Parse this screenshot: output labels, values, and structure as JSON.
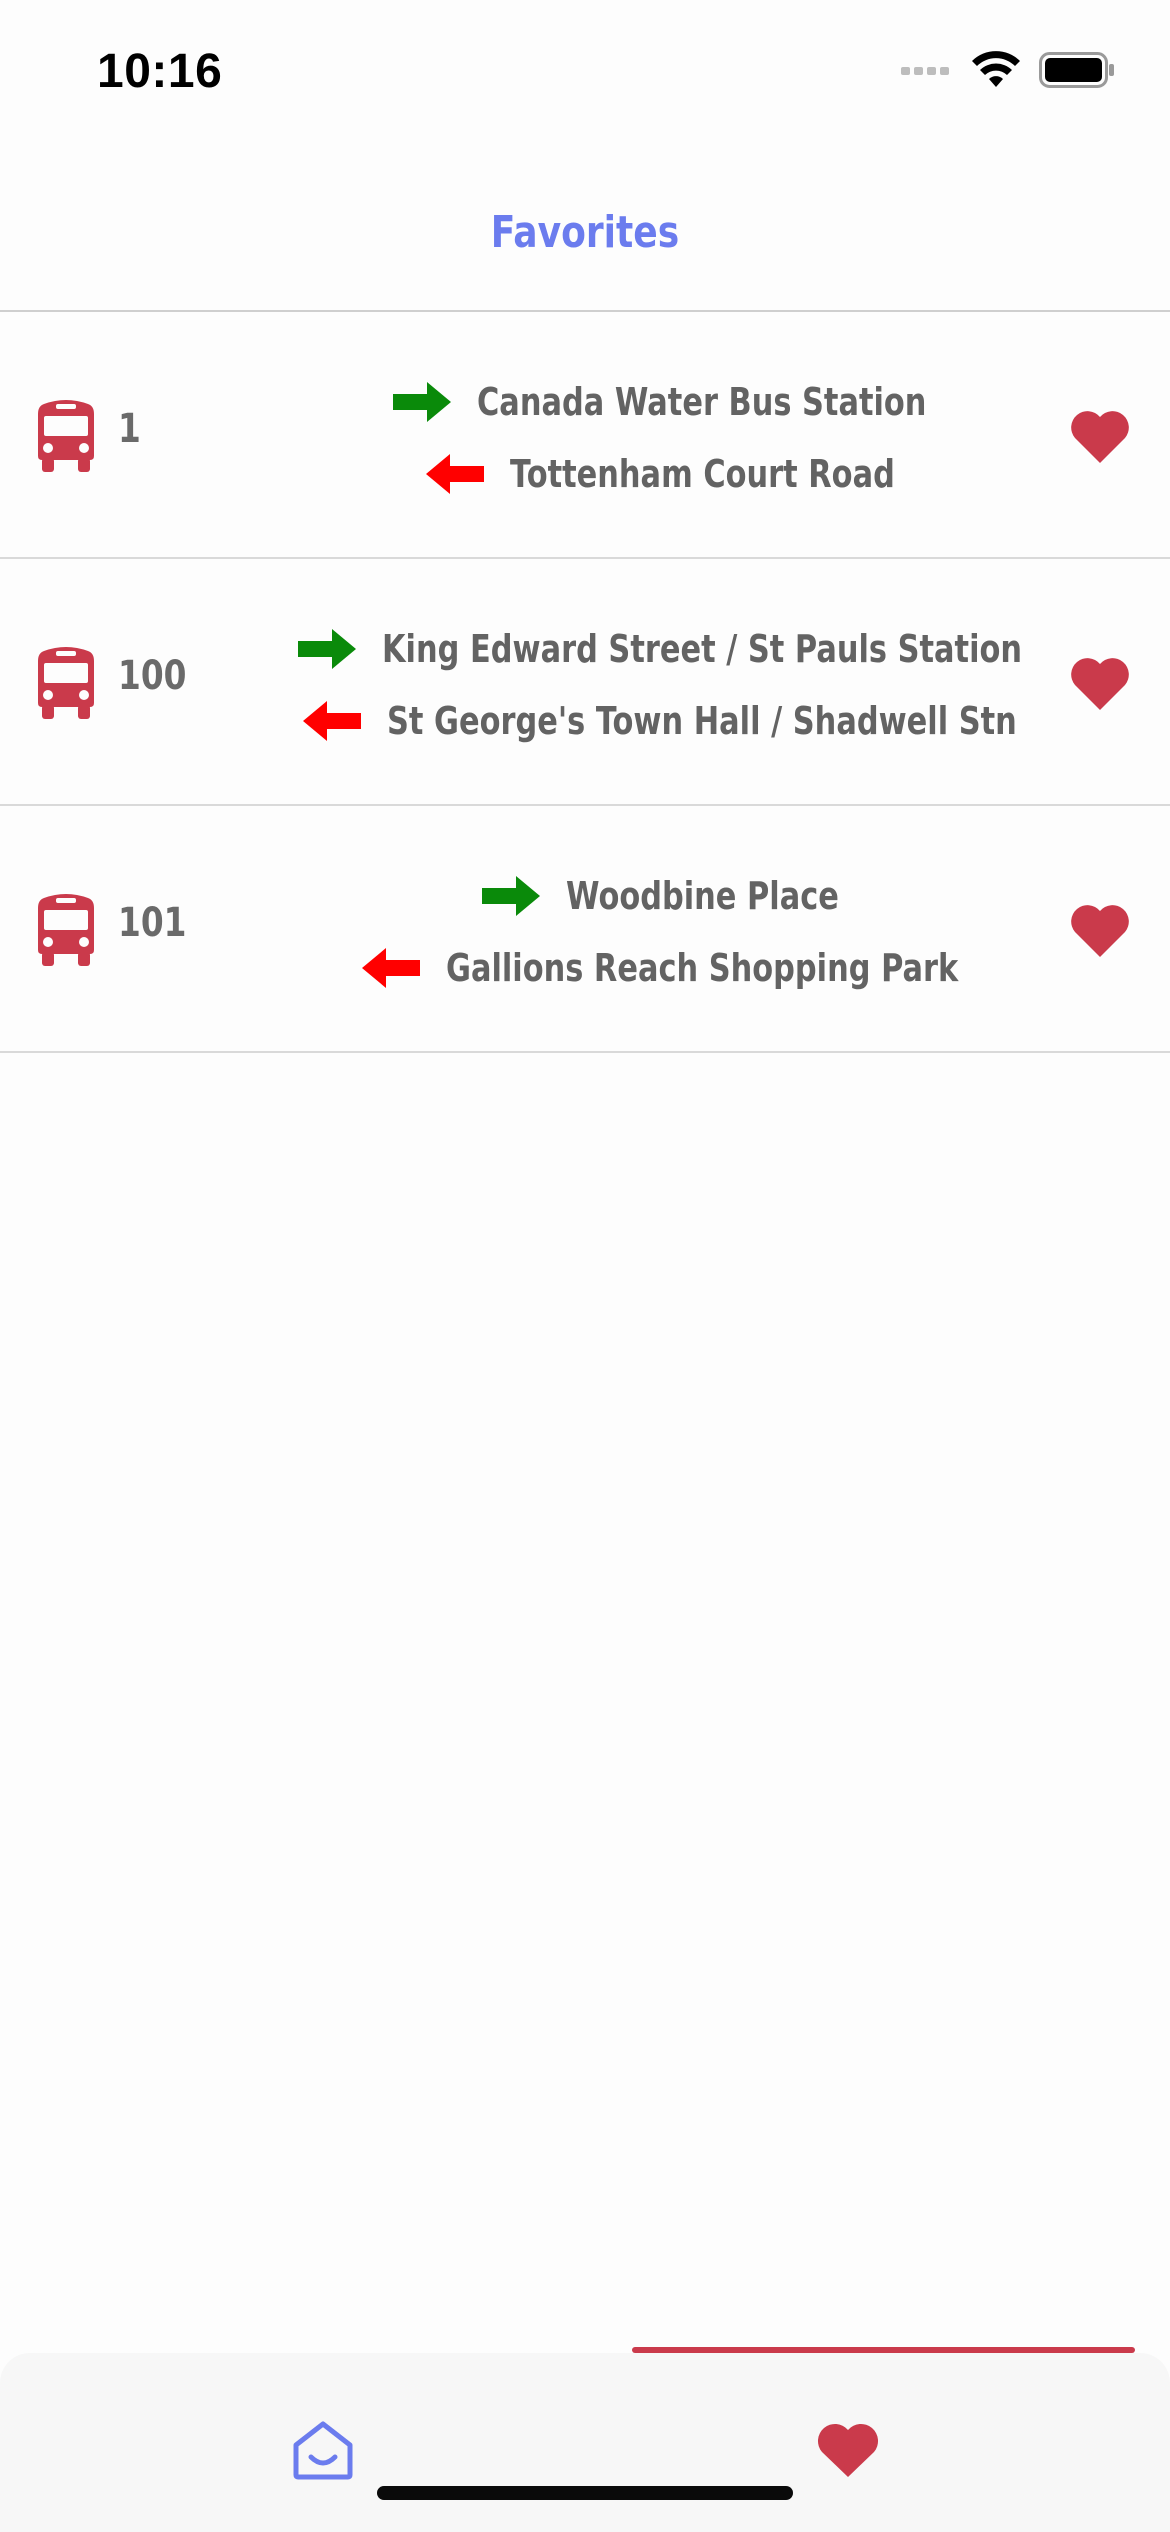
{
  "status_bar": {
    "time": "10:16",
    "icons": [
      "signal-icon",
      "wifi-icon",
      "battery-icon"
    ]
  },
  "header": {
    "title": "Favorites"
  },
  "favorites": [
    {
      "route": "1",
      "outbound": "Canada Water Bus Station",
      "inbound": "Tottenham Court Road"
    },
    {
      "route": "100",
      "outbound": "King Edward Street / St Pauls Station",
      "inbound": "St George's Town Hall / Shadwell Stn"
    },
    {
      "route": "101",
      "outbound": "Woodbine Place",
      "inbound": "Gallions Reach Shopping Park"
    }
  ],
  "tab_bar": {
    "tabs": [
      {
        "icon": "home-icon",
        "selected": false
      },
      {
        "icon": "heart-icon",
        "selected": true
      }
    ]
  },
  "colors": {
    "accent": "#6b7cee",
    "bus_red": "#ca3a4b",
    "outbound_arrow": "#0a8a0a",
    "inbound_arrow": "#ff0000",
    "text_gray": "#636363"
  }
}
